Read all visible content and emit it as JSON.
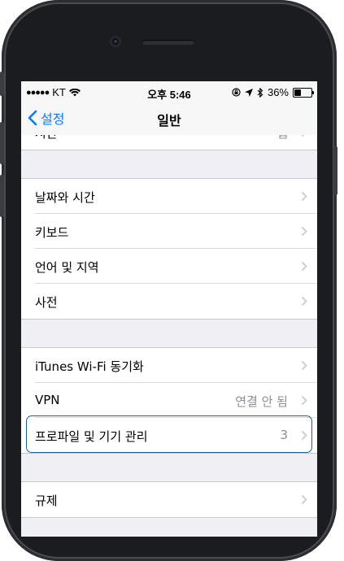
{
  "status_bar": {
    "signal": "●●●●●",
    "carrier": "KT",
    "time": "오후 5:46",
    "battery": "36%"
  },
  "navbar": {
    "back_label": "설정",
    "title": "일반"
  },
  "partial_row": {
    "label": "시간",
    "value": "냅"
  },
  "groups": [
    {
      "rows": [
        {
          "label": "날짜와 시간",
          "value": ""
        },
        {
          "label": "키보드",
          "value": ""
        },
        {
          "label": "언어 및 지역",
          "value": ""
        },
        {
          "label": "사전",
          "value": ""
        }
      ]
    },
    {
      "rows": [
        {
          "label": "iTunes Wi-Fi 동기화",
          "value": ""
        },
        {
          "label": "VPN",
          "value": "연결 안 됨"
        },
        {
          "label": "프로파일 및 기기 관리",
          "value": "3"
        }
      ]
    },
    {
      "rows": [
        {
          "label": "규제",
          "value": ""
        }
      ]
    }
  ],
  "colors": {
    "accent": "#0a7aff",
    "highlight_border": "#1f5f8f",
    "background": "#efeff4",
    "secondary_text": "#8e8e93"
  }
}
